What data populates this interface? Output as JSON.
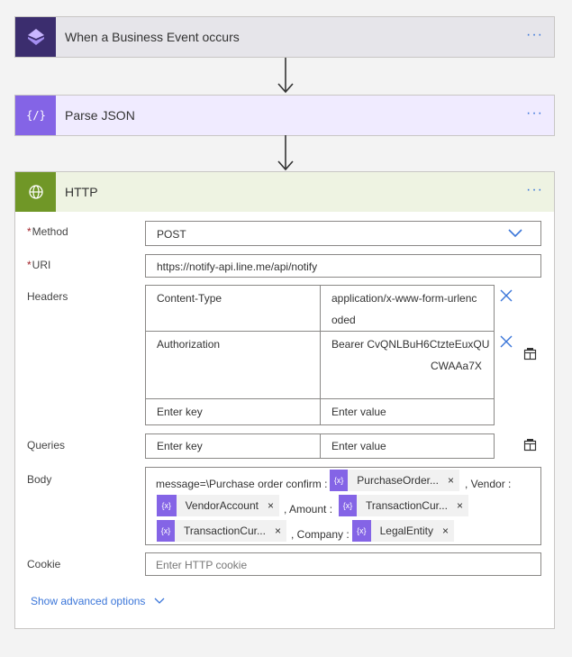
{
  "steps": [
    {
      "title": "When a Business Event occurs",
      "more": "···"
    },
    {
      "title": "Parse JSON",
      "more": "···"
    },
    {
      "title": "HTTP",
      "more": "···"
    }
  ],
  "http": {
    "method": {
      "required_mark": "*",
      "label": "Method",
      "value": "POST"
    },
    "uri": {
      "required_mark": "*",
      "label": "URI",
      "value": "https://notify-api.line.me/api/notify"
    },
    "headers": {
      "label": "Headers",
      "rows": [
        {
          "key": "Content-Type",
          "value_line1": "application/x-www-form-urlenc",
          "value_line2": "oded"
        },
        {
          "key": "Authorization",
          "value_line1": "Bearer CvQNLBuH6CtzteEuxQU",
          "value_line2": "CWAAa7X"
        }
      ],
      "key_placeholder": "Enter key",
      "value_placeholder": "Enter value"
    },
    "queries": {
      "label": "Queries",
      "key_placeholder": "Enter key",
      "value_placeholder": "Enter value"
    },
    "body": {
      "label": "Body",
      "text1": "message=\\Purchase order confirm :",
      "token1": "PurchaseOrder...",
      "text2": ", Vendor :",
      "token2": "VendorAccount",
      "text3": ", Amount :",
      "token3": "TransactionCur...",
      "token4": "TransactionCur...",
      "text4": ", Company :",
      "token5": "LegalEntity",
      "token_icon": "{x}",
      "remove": "×"
    },
    "cookie": {
      "label": "Cookie",
      "placeholder": "Enter HTTP cookie"
    },
    "advanced": "Show advanced options"
  },
  "colors": {
    "trigger_icon": "#3b2d6e",
    "parse_icon": "#8464e6",
    "http_icon": "#709727",
    "parse_header": "#f0ebff",
    "http_header": "#eef3e2",
    "trigger_header": "#e6e5ea",
    "accent": "#3b76d9"
  }
}
